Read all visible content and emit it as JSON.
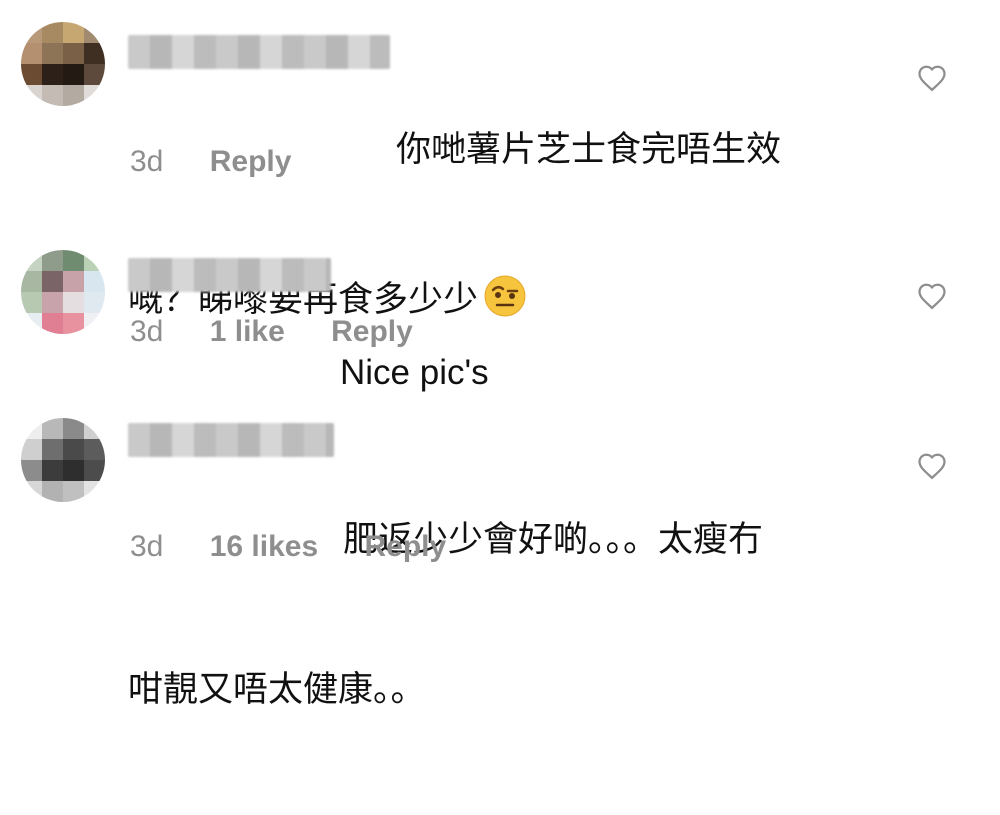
{
  "comments": [
    {
      "text_line1": "你哋薯片芝士食完唔生效",
      "text_line2": "嘅？睇嚟要再食多少少",
      "emoji": "raised-eyebrow-face-emoji",
      "time": "3d",
      "likes": "",
      "reply_label": "Reply"
    },
    {
      "text_line1": "Nice pic's",
      "text_line2": "",
      "time": "3d",
      "likes": "1 like",
      "reply_label": "Reply"
    },
    {
      "text_line1": "肥返少少會好啲。。。太瘦冇",
      "text_line2": "咁靚又唔太健康。。",
      "time": "3d",
      "likes": "16 likes",
      "reply_label": "Reply"
    }
  ],
  "icons": {
    "like": "heart-outline-icon"
  },
  "colors": {
    "meta_text": "#8e8e8e",
    "body_text": "#111111"
  }
}
